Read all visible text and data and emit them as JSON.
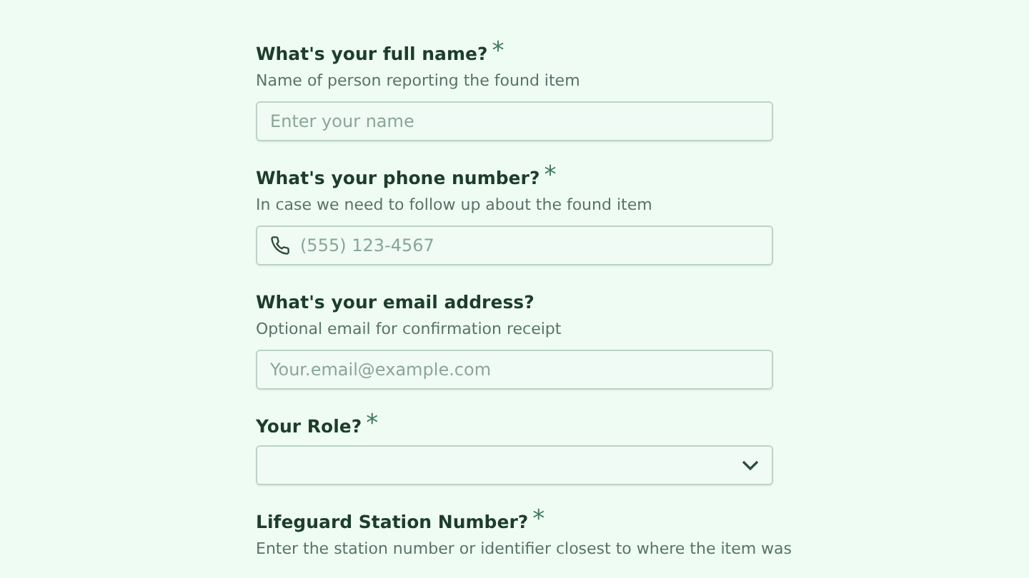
{
  "fields": [
    {
      "kind": "text",
      "label": "What's your full name?",
      "required_mark": "*",
      "description": "Name of person reporting the found item",
      "placeholder": "Enter your name"
    },
    {
      "kind": "phone",
      "label": "What's your phone number?",
      "required_mark": "*",
      "description": "In case we need to follow up about the found item",
      "placeholder": "(555) 123-4567"
    },
    {
      "kind": "text",
      "label": "What's your email address?",
      "description": "Optional email for confirmation receipt",
      "placeholder": "Your.email@example.com"
    },
    {
      "kind": "select",
      "label": "Your Role?",
      "required_mark": "*"
    },
    {
      "kind": "heading",
      "label": "Lifeguard Station Number?",
      "required_mark": "*",
      "description": "Enter the station number or identifier closest to where the item was"
    }
  ]
}
